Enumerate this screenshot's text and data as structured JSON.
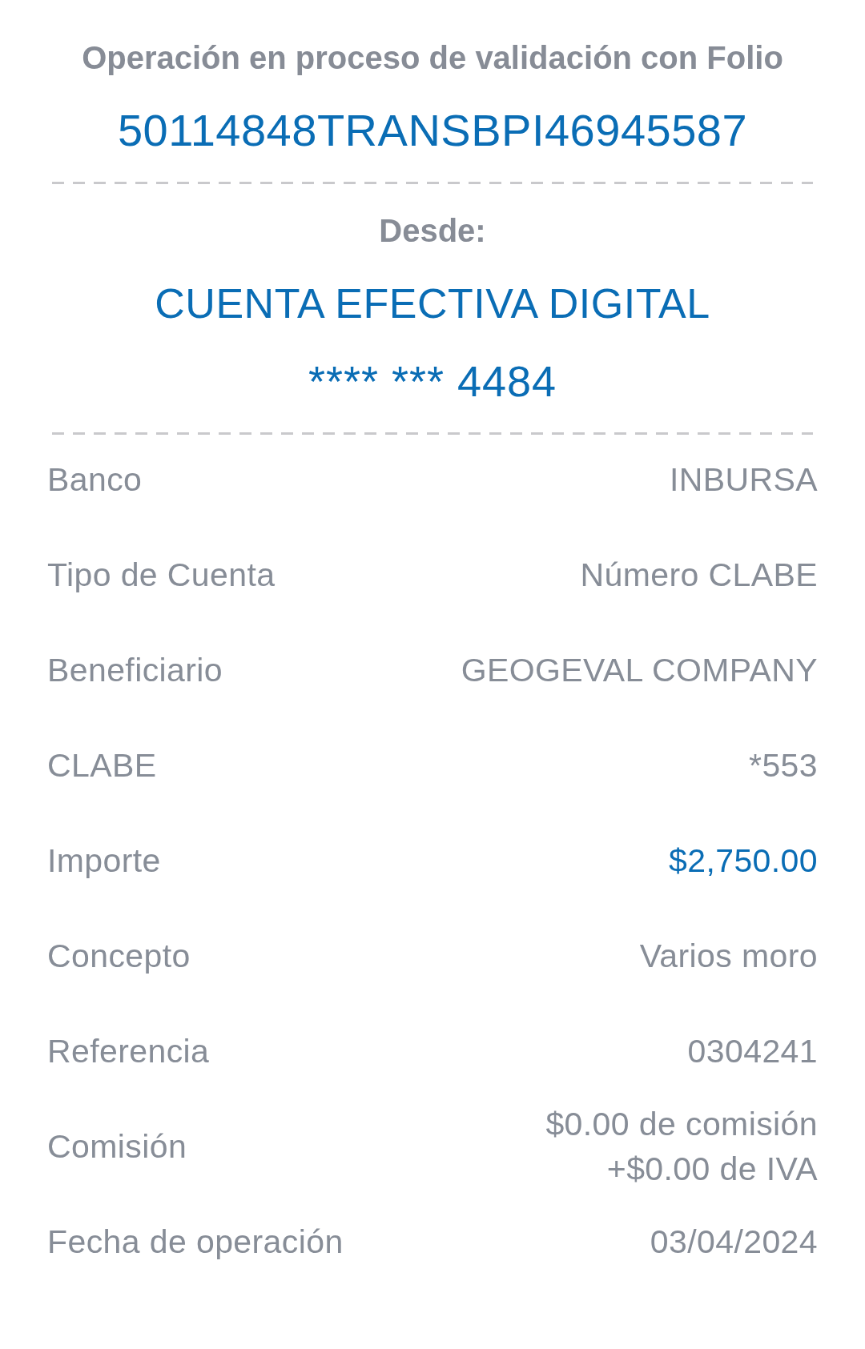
{
  "header": {
    "title": "Operación en proceso de validación con Folio",
    "folio": "50114848TRANSBPI46945587"
  },
  "origin": {
    "label": "Desde:",
    "account_name": "CUENTA EFECTIVA DIGITAL",
    "account_number": "**** *** 4484"
  },
  "details": [
    {
      "kind": "text",
      "label": "Banco",
      "value": "INBURSA"
    },
    {
      "kind": "text",
      "label": "Tipo de Cuenta",
      "value": "Número CLABE"
    },
    {
      "kind": "text",
      "label": "Beneficiario",
      "value": "GEOGEVAL COMPANY"
    },
    {
      "kind": "text",
      "label": "CLABE",
      "value": "*553"
    },
    {
      "kind": "amount",
      "label": "Importe",
      "value": "$2,750.00"
    },
    {
      "kind": "text",
      "label": "Concepto",
      "value": "Varios moro"
    },
    {
      "kind": "text",
      "label": "Referencia",
      "value": "0304241"
    },
    {
      "kind": "lines",
      "label": "Comisión",
      "lines": [
        "$0.00 de comisión",
        "+$0.00 de IVA"
      ]
    },
    {
      "kind": "text",
      "label": "Fecha de operación",
      "value": "03/04/2024"
    }
  ]
}
